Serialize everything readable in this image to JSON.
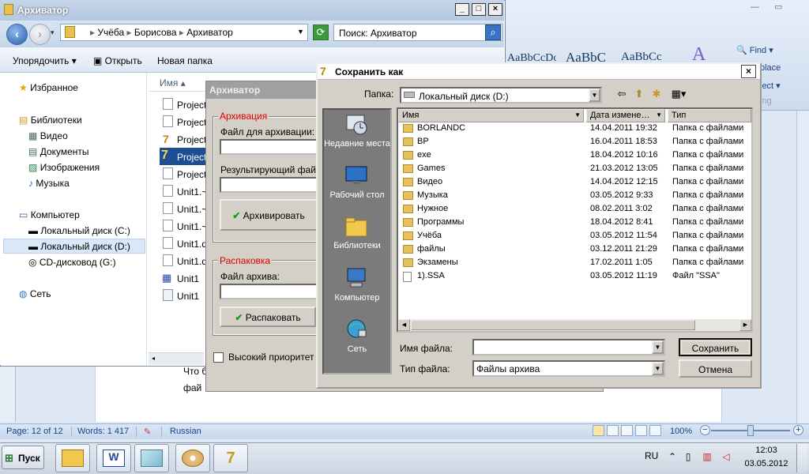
{
  "word": {
    "styles": [
      "AaBbCcDc",
      "AaBbC",
      "AaBbCc"
    ],
    "edit_group": {
      "find": "Find",
      "replace": "place",
      "select": "lect",
      "group_label": "ing"
    },
    "doc_lines": [
      "Что б",
      "фай"
    ],
    "status": {
      "page": "Page: 12 of 12",
      "words": "Words: 1 417",
      "language": "Russian",
      "zoom": "100%"
    }
  },
  "explorer": {
    "title": "Архиватор",
    "breadcrumb": [
      "Учёба",
      "Борисова",
      "Архиватор"
    ],
    "search_placeholder": "Поиск: Архиватор",
    "toolbar": {
      "organize": "Упорядочить",
      "open": "Открыть",
      "new_folder": "Новая папка"
    },
    "nav": {
      "favorites": "Избранное",
      "libraries": "Библиотеки",
      "lib_items": [
        "Видео",
        "Документы",
        "Изображения",
        "Музыка"
      ],
      "computer": "Компьютер",
      "drives": [
        "Локальный диск (C:)",
        "Локальный диск (D:)",
        "CD-дисковод (G:)"
      ],
      "network": "Сеть"
    },
    "column_name": "Имя",
    "files": [
      "Project",
      "Project",
      "Project",
      "Project",
      "Project",
      "Unit1.~",
      "Unit1.~",
      "Unit1.~",
      "Unit1.d",
      "Unit1.d",
      "Unit1",
      "Unit1"
    ]
  },
  "archivator": {
    "title": "Архиватор",
    "pack_group": "Архивация",
    "file_to_archive_label": "Файл для архивации:",
    "result_file_label": "Результирующий файл а",
    "archive_button": "Архивировать",
    "unpack_group": "Распаковка",
    "archive_file_label": "Файл архива:",
    "unpack_button": "Распаковать",
    "high_priority_label": "Высокий приоритет пр"
  },
  "save_dialog": {
    "title": "Сохранить как",
    "folder_label": "Папка:",
    "folder_value": "Локальный диск (D:)",
    "places": [
      {
        "label": "Недавние места",
        "icon": "recent-places-icon"
      },
      {
        "label": "Рабочий стол",
        "icon": "desktop-icon"
      },
      {
        "label": "Библиотеки",
        "icon": "libraries-icon"
      },
      {
        "label": "Компьютер",
        "icon": "computer-icon"
      },
      {
        "label": "Сеть",
        "icon": "network-icon"
      }
    ],
    "columns": {
      "name": "Имя",
      "date": "Дата измене…",
      "type": "Тип"
    },
    "items": [
      {
        "name": "BORLANDC",
        "date": "14.04.2011 19:32",
        "type": "Папка с файлами"
      },
      {
        "name": "BP",
        "date": "16.04.2011 18:53",
        "type": "Папка с файлами"
      },
      {
        "name": "exe",
        "date": "18.04.2012 10:16",
        "type": "Папка с файлами"
      },
      {
        "name": "Games",
        "date": "21.03.2012 13:05",
        "type": "Папка с файлами"
      },
      {
        "name": "Видео",
        "date": "14.04.2012 12:15",
        "type": "Папка с файлами"
      },
      {
        "name": "Музыка",
        "date": "03.05.2012 9:33",
        "type": "Папка с файлами"
      },
      {
        "name": "Нужное",
        "date": "08.02.2011 3:02",
        "type": "Папка с файлами"
      },
      {
        "name": "Программы",
        "date": "18.04.2012 8:41",
        "type": "Папка с файлами"
      },
      {
        "name": "Учёба",
        "date": "03.05.2012 11:54",
        "type": "Папка с файлами"
      },
      {
        "name": "файлы",
        "date": "03.12.2011 21:29",
        "type": "Папка с файлами"
      },
      {
        "name": "Экзамены",
        "date": "17.02.2011 1:05",
        "type": "Папка с файлами"
      },
      {
        "name": "1).SSA",
        "date": "03.05.2012 11:19",
        "type": "Файл \"SSA\""
      }
    ],
    "filename_label": "Имя файла:",
    "filename_value": "",
    "filetype_label": "Тип файла:",
    "filetype_value": "Файлы архива",
    "save_button": "Сохранить",
    "cancel_button": "Отмена"
  },
  "taskbar": {
    "start": "Пуск",
    "lang": "RU",
    "time": "12:03",
    "date": "03.05.2012"
  }
}
